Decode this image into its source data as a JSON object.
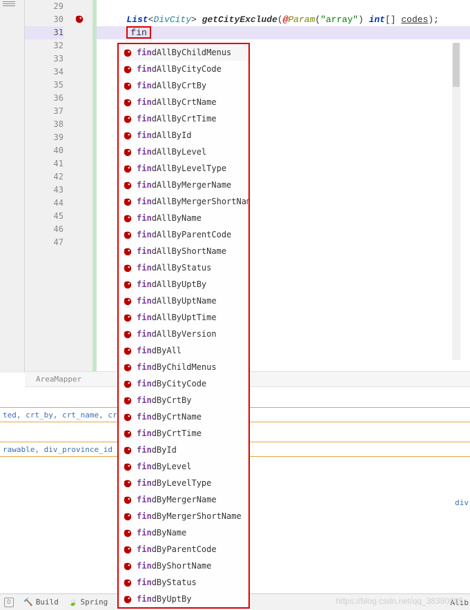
{
  "gutter": {
    "start": 29,
    "end": 47,
    "current": 31
  },
  "code": {
    "l30": {
      "kw_list": "List",
      "generic": "DivCity",
      "method": "getCityExclude",
      "ann": "Param",
      "ann_sigil": "@",
      "str": "\"array\"",
      "kw_int": "int",
      "brackets": "[]",
      "param": "codes",
      "semi": ";"
    },
    "l31": {
      "typed": "fin"
    }
  },
  "breadcrumb": "AreaMapper",
  "bottom": {
    "row1": "ted, crt_by, crt_name, crt",
    "row2": "rawable, div_province_id",
    "row2_right": "div"
  },
  "statusbar": {
    "d": "D",
    "build": "Build",
    "spring": "Spring",
    "right": "Alib"
  },
  "popup": {
    "prefix_len": 3,
    "items": [
      "findAllByChildMenus",
      "findAllByCityCode",
      "findAllByCrtBy",
      "findAllByCrtName",
      "findAllByCrtTime",
      "findAllById",
      "findAllByLevel",
      "findAllByLevelType",
      "findAllByMergerName",
      "findAllByMergerShortName",
      "findAllByName",
      "findAllByParentCode",
      "findAllByShortName",
      "findAllByStatus",
      "findAllByUptBy",
      "findAllByUptName",
      "findAllByUptTime",
      "findAllByVersion",
      "findByAll",
      "findByChildMenus",
      "findByCityCode",
      "findByCrtBy",
      "findByCrtName",
      "findByCrtTime",
      "findById",
      "findByLevel",
      "findByLevelType",
      "findByMergerName",
      "findByMergerShortName",
      "findByName",
      "findByParentCode",
      "findByShortName",
      "findByStatus",
      "findByUptBy"
    ]
  },
  "watermark": "https://blog.csdn.net/qq_38380025"
}
